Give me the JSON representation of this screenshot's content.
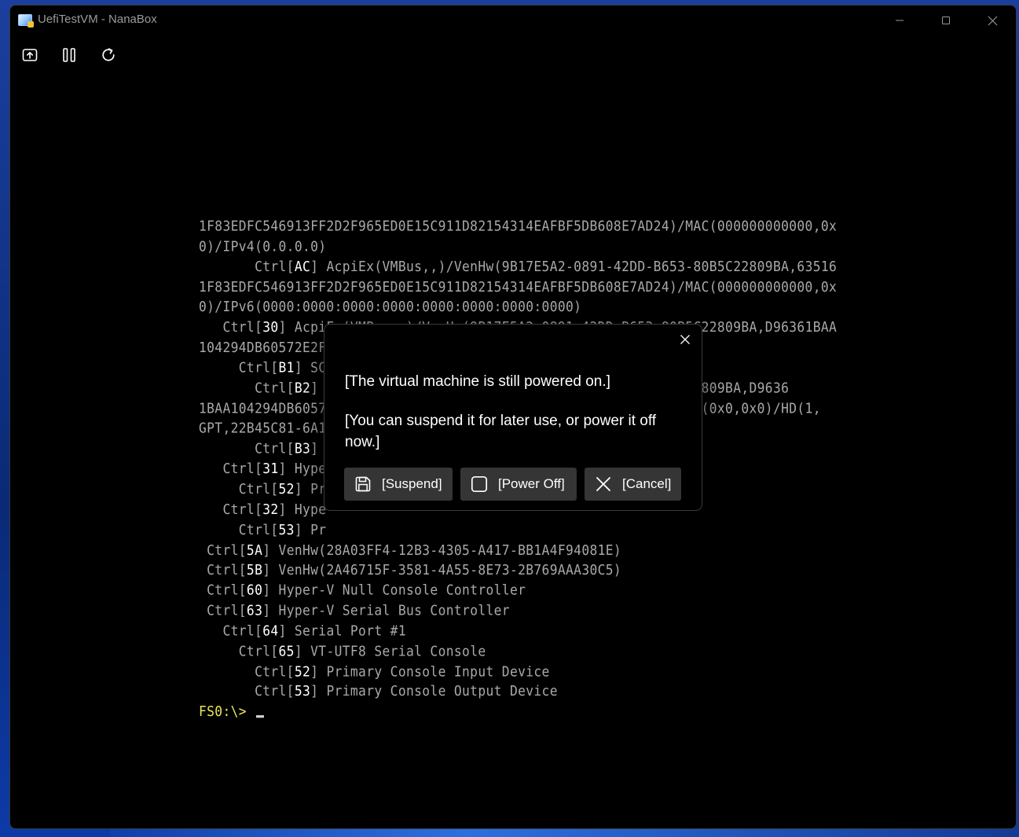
{
  "window": {
    "title": "UefiTestVM - NanaBox"
  },
  "toolbar": {
    "enhanced_session_icon": "enhanced-session-icon",
    "pause_icon": "pause-icon",
    "reset_icon": "reset-icon"
  },
  "console": {
    "lines": [
      [
        [
          "1F83EDFC546913FF2D2F965ED0E15C911D82154314EAFBF5DB608E7AD24)/MAC(000000000000,0x",
          "n"
        ]
      ],
      [
        [
          "0)/IPv4(0.0.0.0)",
          "n"
        ]
      ],
      [
        [
          "       Ctrl[",
          "n"
        ],
        [
          "AC",
          "h"
        ],
        [
          "] AcpiEx(VMBus,,)/VenHw(9B17E5A2-0891-42DD-B653-80B5C22809BA,63516",
          "n"
        ]
      ],
      [
        [
          "1F83EDFC546913FF2D2F965ED0E15C911D82154314EAFBF5DB608E7AD24)/MAC(000000000000,0x",
          "n"
        ]
      ],
      [
        [
          "0)/IPv6(0000:0000:0000:0000:0000:0000:0000:0000)",
          "n"
        ]
      ],
      [
        [
          "   Ctrl[",
          "n"
        ],
        [
          "30",
          "h"
        ],
        [
          "] AcpiEx(VMBus,,)/VenHw(9B17E5A2-0891-42DD-B653-80B5C22809BA,D96361BAA",
          "n"
        ]
      ],
      [
        [
          "104294DB60572E2F",
          "n"
        ]
      ],
      [
        [
          "     Ctrl[",
          "n"
        ],
        [
          "B1",
          "h"
        ],
        [
          "] SC",
          "n"
        ]
      ],
      [
        [
          "       Ctrl[",
          "n"
        ],
        [
          "B2",
          "h"
        ],
        [
          "]                                           B5C22809BA,D9636",
          "n"
        ]
      ],
      [
        [
          "1BAA104294DB6057                                              i(0x0,0x0)/HD(1,",
          "n"
        ]
      ],
      [
        [
          "GPT,22B45C81-6A1",
          "n"
        ]
      ],
      [
        [
          "       Ctrl[",
          "n"
        ],
        [
          "B3",
          "h"
        ],
        [
          "]",
          "n"
        ]
      ],
      [
        [
          "   Ctrl[",
          "n"
        ],
        [
          "31",
          "h"
        ],
        [
          "] Hype",
          "n"
        ]
      ],
      [
        [
          "     Ctrl[",
          "n"
        ],
        [
          "52",
          "h"
        ],
        [
          "] Pr",
          "n"
        ]
      ],
      [
        [
          "   Ctrl[",
          "n"
        ],
        [
          "32",
          "h"
        ],
        [
          "] Hype",
          "n"
        ]
      ],
      [
        [
          "     Ctrl[",
          "n"
        ],
        [
          "53",
          "h"
        ],
        [
          "] Pr",
          "n"
        ]
      ],
      [
        [
          " Ctrl[",
          "n"
        ],
        [
          "5A",
          "h"
        ],
        [
          "] VenHw(28A03FF4-12B3-4305-A417-BB1A4F94081E)",
          "n"
        ]
      ],
      [
        [
          " Ctrl[",
          "n"
        ],
        [
          "5B",
          "h"
        ],
        [
          "] VenHw(2A46715F-3581-4A55-8E73-2B769AAA30C5)",
          "n"
        ]
      ],
      [
        [
          " Ctrl[",
          "n"
        ],
        [
          "60",
          "h"
        ],
        [
          "] Hyper-V Null Console Controller",
          "n"
        ]
      ],
      [
        [
          " Ctrl[",
          "n"
        ],
        [
          "63",
          "h"
        ],
        [
          "] Hyper-V Serial Bus Controller",
          "n"
        ]
      ],
      [
        [
          "   Ctrl[",
          "n"
        ],
        [
          "64",
          "h"
        ],
        [
          "] Serial Port #1",
          "n"
        ]
      ],
      [
        [
          "     Ctrl[",
          "n"
        ],
        [
          "65",
          "h"
        ],
        [
          "] VT-UTF8 Serial Console",
          "n"
        ]
      ],
      [
        [
          "       Ctrl[",
          "n"
        ],
        [
          "52",
          "h"
        ],
        [
          "] Primary Console Input Device",
          "n"
        ]
      ],
      [
        [
          "       Ctrl[",
          "n"
        ],
        [
          "53",
          "h"
        ],
        [
          "] Primary Console Output Device",
          "n"
        ]
      ]
    ],
    "prompt": "FS0:\\> "
  },
  "dialog": {
    "title": "[The virtual machine is still powered on.]",
    "message": "[You can suspend it for later use, or power it off now.]",
    "buttons": {
      "suspend": "[Suspend]",
      "power_off": "[Power Off]",
      "cancel": "[Cancel]"
    },
    "icons": {
      "suspend": "save-icon",
      "power_off": "stop-square-icon",
      "cancel": "close-icon",
      "dialog_close": "close-icon"
    }
  },
  "colors": {
    "console_text": "#a9a9a9",
    "console_highlight": "#ffffff",
    "prompt": "#e8e85a",
    "dialog_button_bg": "#353535",
    "title_text": "#9a9a9a"
  }
}
